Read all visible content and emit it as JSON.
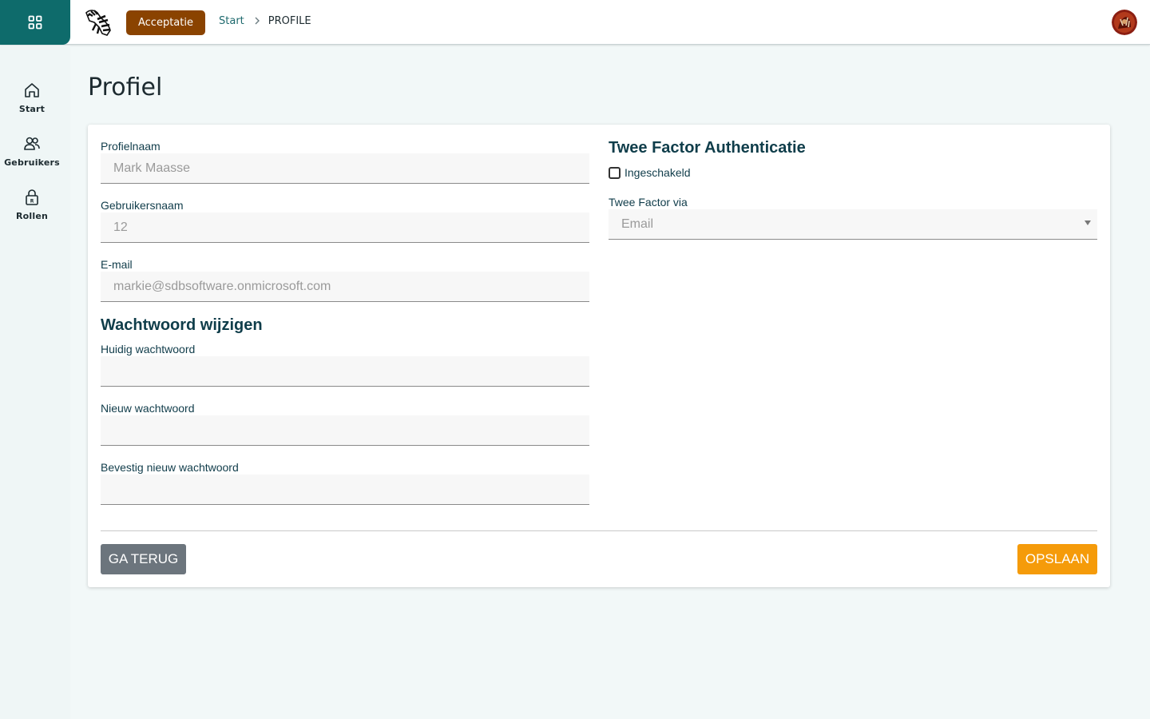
{
  "header": {
    "apps_icon": "grid-icon",
    "logo_icon": "zebra-logo-icon",
    "environment_badge": "Acceptatie",
    "breadcrumb": {
      "home": "Start",
      "separator": ">",
      "current": "PROFILE"
    },
    "avatar_icon": "user-avatar-icon"
  },
  "sidebar": {
    "items": [
      {
        "label": "Start",
        "icon": "home-icon"
      },
      {
        "label": "Gebruikers",
        "icon": "users-icon"
      },
      {
        "label": "Rollen",
        "icon": "lock-icon"
      }
    ]
  },
  "page": {
    "title": "Profiel"
  },
  "profile": {
    "name_label": "Profielnaam",
    "name_value": "Mark Maasse",
    "username_label": "Gebruikersnaam",
    "username_value": "12",
    "email_label": "E-mail",
    "email_value": "markie@sdbsoftware.onmicrosoft.com"
  },
  "password": {
    "section_title": "Wachtwoord wijzigen",
    "current_label": "Huidig wachtwoord",
    "current_value": "",
    "new_label": "Nieuw wachtwoord",
    "new_value": "",
    "confirm_label": "Bevestig nieuw wachtwoord",
    "confirm_value": ""
  },
  "two_factor": {
    "section_title": "Twee Factor Authenticatie",
    "enabled_label": "Ingeschakeld",
    "enabled": false,
    "via_label": "Twee Factor via",
    "via_value": "Email"
  },
  "actions": {
    "back_label": "GA TERUG",
    "save_label": "OPSLAAN"
  },
  "colors": {
    "primary_teal": "#0e6b6b",
    "env_badge": "#8a4300",
    "heading": "#0f3d4a",
    "save_button": "#f59b0a",
    "back_button": "#6c757d",
    "background": "#f2f8f8"
  }
}
